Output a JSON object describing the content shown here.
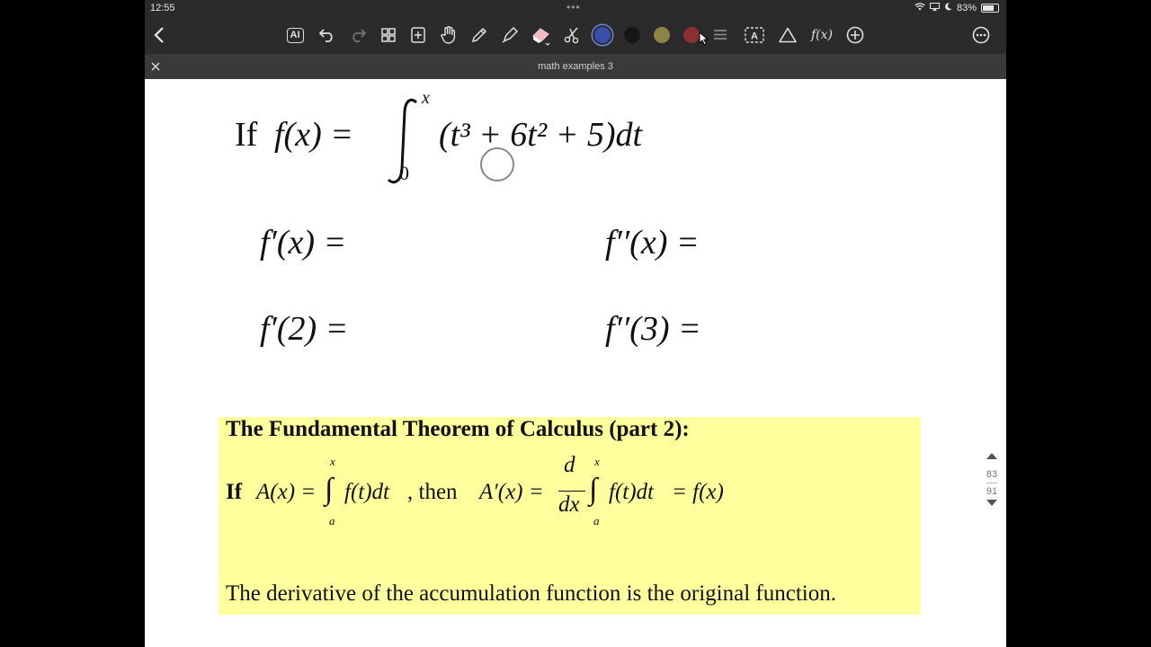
{
  "status": {
    "time": "12:55",
    "battery": "83%",
    "battery_level": 0.83
  },
  "toolbar": {
    "ai_label": "AI",
    "fx_label": "f(x)",
    "swatch_colors": [
      "#3a4fa8",
      "#161616",
      "#8c8447",
      "#8c2f33"
    ]
  },
  "document": {
    "title": "math examples 3"
  },
  "main": {
    "if_word": "If",
    "fx": "f(x) =",
    "integrand": "(t³ + 6t² + 5)dt",
    "upper_limit": "x",
    "lower_limit": "0",
    "q1": "f′(x) =",
    "q2": "f′′(x) =",
    "q3": "f′(2) =",
    "q4": "f′′(3) ="
  },
  "theorem": {
    "heading": "The Fundamental Theorem of Calculus (part 2):",
    "if_word": "If",
    "lhs": "A(x) =",
    "upper": "x",
    "lower": "a",
    "integrand": "f(t)dt",
    "then": ", then",
    "rhs_lhs": "A′(x) =",
    "d_num": "d",
    "d_den": "dx",
    "rhs_end": "= f(x)",
    "caption": "The derivative of the accumulation function is the original function."
  },
  "pagenav": {
    "current": "83",
    "total": "91"
  }
}
